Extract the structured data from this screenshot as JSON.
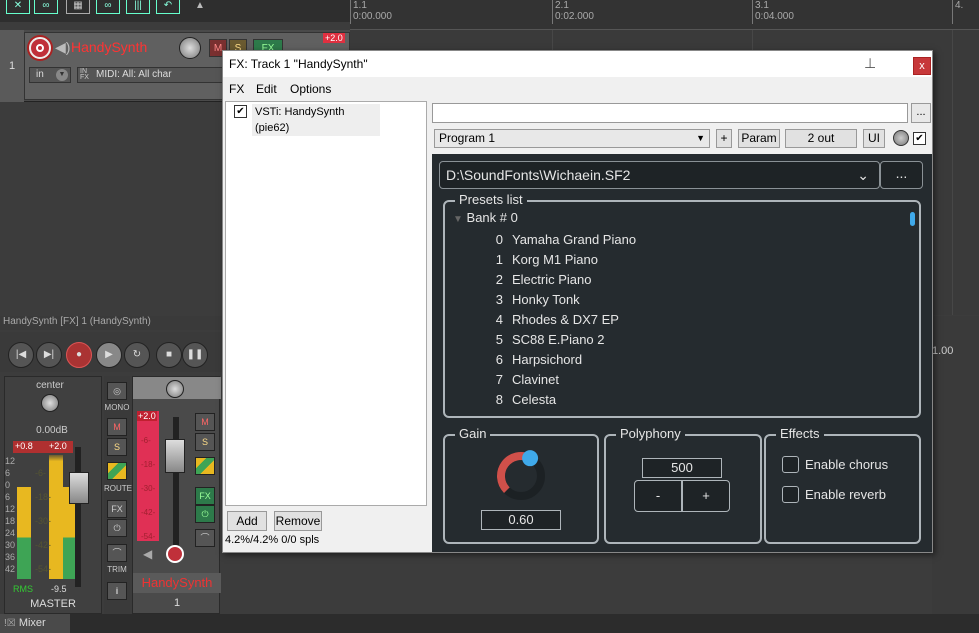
{
  "ruler": {
    "marks": [
      {
        "bar": "1.1",
        "time": "0:00.000"
      },
      {
        "bar": "2.1",
        "time": "0:02.000"
      },
      {
        "bar": "3.1",
        "time": "0:04.000"
      },
      {
        "bar": "4.",
        "time": ""
      }
    ],
    "right_time": "1.00"
  },
  "track": {
    "number": "1",
    "name": "HandySynth",
    "input_label": "in",
    "midi_label": "MIDI: All: All char",
    "volume_badge": "+2.0",
    "mute": "M",
    "solo": "S",
    "fx": "FX"
  },
  "mixer": {
    "header_title": "HandySynth [FX] 1 (HandySynth)",
    "master": {
      "pan_label": "center",
      "volume": "0.00dB",
      "peak_left": "+0.8",
      "peak_right": "+2.0",
      "scale": [
        "12",
        "6",
        "0",
        "6",
        "12",
        "18",
        "24",
        "30",
        "36",
        "42"
      ],
      "inner_scale": [
        "-6-",
        "-18-",
        "-30-",
        "-42-",
        "-54-"
      ],
      "rms_label": "RMS",
      "rms_value": "-9.5",
      "name": "MASTER"
    },
    "master_buttons": {
      "mono": "MONO",
      "mute": "M",
      "solo": "S",
      "route": "ROUTE",
      "fx": "FX",
      "trim": "TRIM",
      "info": "i"
    },
    "track_strip": {
      "peak": "+2.0",
      "scale": [
        "-6-",
        "-18-",
        "-30-",
        "-42-",
        "-54-"
      ],
      "mute": "M",
      "solo": "S",
      "fx": "FX",
      "name": "HandySynth",
      "number": "1"
    },
    "tab_label": "Mixer"
  },
  "fx_window": {
    "title": "FX: Track 1 \"HandySynth\"",
    "close": "x",
    "menu": [
      "FX",
      "Edit",
      "Options"
    ],
    "chain": [
      {
        "label": "VSTi: HandySynth (pie62)",
        "checked": true
      }
    ],
    "add_button": "Add",
    "remove_button": "Remove",
    "status": "4.2%/4.2% 0/0 spls",
    "preset_more": "...",
    "program": "Program 1",
    "plus_button": "+",
    "param_button": "Param",
    "out_button": "2 out",
    "ui_button": "UI",
    "bypass_checked": true
  },
  "plugin": {
    "soundfont_path": "D:\\SoundFonts\\Wichaein.SF2",
    "browse_button": "...",
    "presets_legend": "Presets list",
    "bank_label": "Bank # 0",
    "presets": [
      {
        "num": "0",
        "name": "Yamaha Grand Piano"
      },
      {
        "num": "1",
        "name": "Korg M1 Piano"
      },
      {
        "num": "2",
        "name": "Electric Piano"
      },
      {
        "num": "3",
        "name": "Honky Tonk"
      },
      {
        "num": "4",
        "name": "Rhodes & DX7 EP"
      },
      {
        "num": "5",
        "name": "SC88 E.Piano 2"
      },
      {
        "num": "6",
        "name": "Harpsichord"
      },
      {
        "num": "7",
        "name": "Clavinet"
      },
      {
        "num": "8",
        "name": "Celesta"
      }
    ],
    "gain": {
      "legend": "Gain",
      "value": "0.60",
      "level": 0.6
    },
    "polyphony": {
      "legend": "Polyphony",
      "value": "500",
      "minus": "-",
      "plus": "+"
    },
    "effects": {
      "legend": "Effects",
      "chorus_label": "Enable chorus",
      "chorus_checked": false,
      "reverb_label": "Enable reverb",
      "reverb_checked": false
    },
    "colors": {
      "background": "#252b2f",
      "accent": "#3fa9ea",
      "knob_arc": "#d0504a"
    }
  }
}
